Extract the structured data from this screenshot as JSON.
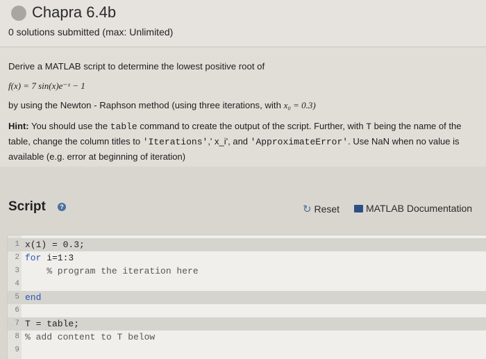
{
  "header": {
    "title": "Chapra 6.4b",
    "subtitle": "0 solutions submitted (max: Unlimited)"
  },
  "problem": {
    "line1": "Derive a MATLAB script to determine the lowest positive root of",
    "formula": "f(x) = 7 sin(x)e⁻ˣ − 1",
    "line3_prefix": "by using the Newton - Raphson method (using three iterations, with ",
    "line3_x0": "x₀ = 0.3)",
    "hint_label": "Hint:",
    "hint_1": " You should use the ",
    "hint_table": "table",
    "hint_2": " command to create the output of the script. Further, with ",
    "hint_T": "T",
    "hint_3": " being the name of the table, change the column titles to ",
    "hint_iter": "'Iterations'",
    "hint_4": ",' x_i', and ",
    "hint_approx": "'ApproximateError'",
    "hint_5": ". Use NaN when no value is available (e.g. error at beginning of iteration)"
  },
  "script": {
    "title": "Script",
    "info_symbol": "?",
    "reset_label": "Reset",
    "reset_symbol": "↻",
    "docs_label": "MATLAB Documentation"
  },
  "code": {
    "lines": [
      {
        "n": "1",
        "kw": "",
        "text": "x(1) = 0.3;"
      },
      {
        "n": "2",
        "kw": "for",
        "text": " i=1:3"
      },
      {
        "n": "3",
        "kw": "",
        "text": "    % program the iteration here"
      },
      {
        "n": "4",
        "kw": "",
        "text": ""
      },
      {
        "n": "5",
        "kw": "end",
        "text": ""
      },
      {
        "n": "6",
        "kw": "",
        "text": ""
      },
      {
        "n": "7",
        "kw": "",
        "text": "T = table;"
      },
      {
        "n": "8",
        "kw": "",
        "text": "% add content to T below"
      },
      {
        "n": "9",
        "kw": "",
        "text": ""
      }
    ]
  }
}
